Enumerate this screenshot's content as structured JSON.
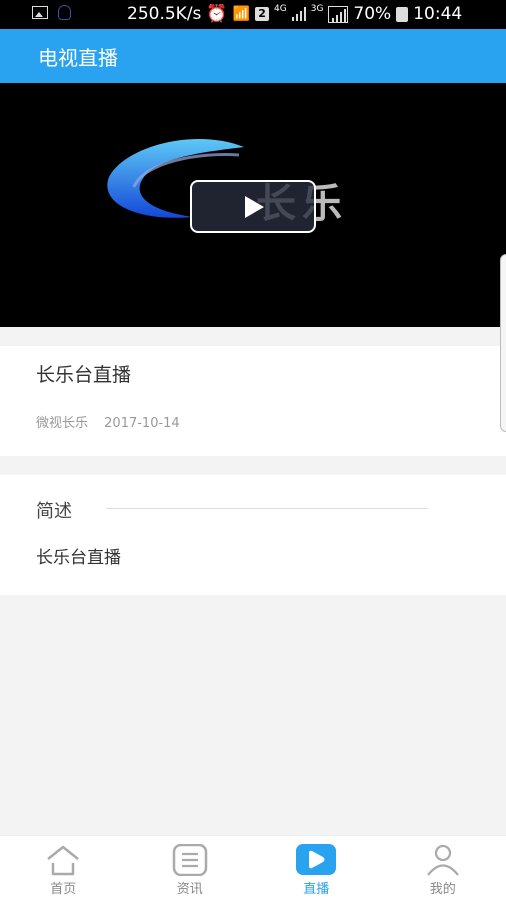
{
  "status_bar": {
    "net_speed": "250.5K/s",
    "sim_badge": "2",
    "net1": "4G",
    "net2": "3G",
    "battery": "70%",
    "time": "10:44",
    "icons": [
      "gallery-icon",
      "qq-icon",
      "alarm-icon",
      "wifi-icon",
      "signal-icon",
      "battery-charging-icon"
    ]
  },
  "appbar": {
    "title": "电视直播"
  },
  "video": {
    "logo_text": "长乐",
    "play_icon": "play-icon"
  },
  "program": {
    "title": "长乐台直播",
    "source": "微视长乐",
    "date": "2017-10-14"
  },
  "summary": {
    "label": "简述",
    "text": "长乐台直播"
  },
  "bottom_nav": {
    "active": "直播",
    "items": [
      {
        "label": "首页",
        "icon": "home-icon"
      },
      {
        "label": "资讯",
        "icon": "news-icon"
      },
      {
        "label": "直播",
        "icon": "live-icon"
      },
      {
        "label": "我的",
        "icon": "profile-icon"
      }
    ]
  },
  "colors": {
    "accent": "#29a3ef",
    "inactive": "#888888"
  }
}
